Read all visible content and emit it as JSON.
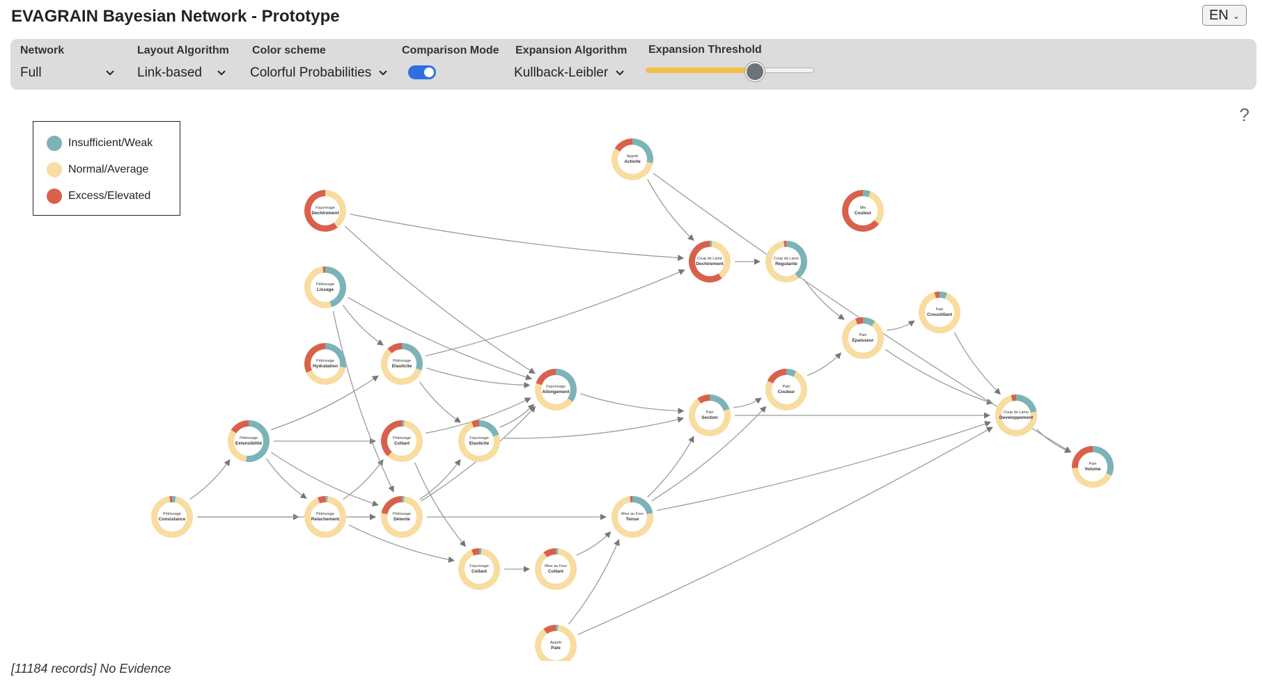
{
  "app": {
    "title": "EVAGRAIN Bayesian Network - Prototype"
  },
  "language": {
    "value": "EN"
  },
  "toolbar": {
    "network": {
      "label": "Network",
      "value": "Full"
    },
    "layout": {
      "label": "Layout Algorithm",
      "value": "Link-based"
    },
    "color_scheme": {
      "label": "Color scheme",
      "value": "Colorful Probabilities"
    },
    "comparison": {
      "label": "Comparison Mode",
      "enabled": true
    },
    "expansion_algo": {
      "label": "Expansion Algorithm",
      "value": "Kullback-Leibler"
    },
    "expansion_threshold": {
      "label": "Expansion Threshold",
      "value": 0.64
    }
  },
  "help": {
    "text": "?"
  },
  "legend": {
    "items": [
      {
        "label": "Insufficient/Weak",
        "color": "#7bb3b8"
      },
      {
        "label": "Normal/Average",
        "color": "#f8dca0"
      },
      {
        "label": "Excess/Elevated",
        "color": "#d9604b"
      }
    ]
  },
  "colors": {
    "weak": "#7bb3b8",
    "normal": "#f8dca0",
    "excess": "#d9604b",
    "toggle_on": "#2f6fe0",
    "slider_fill": "#f4c04a"
  },
  "status": {
    "text": "[11184 records] No Evidence"
  },
  "network": {
    "nodes": [
      {
        "id": "cons",
        "group": "Pétrissage",
        "name": "Consistance",
        "p": {
          "weak": 0.03,
          "normal": 0.95,
          "excess": 0.02
        }
      },
      {
        "id": "exten",
        "group": "Pétrissage",
        "name": "Extensibilité",
        "p": {
          "weak": 0.52,
          "normal": 0.32,
          "excess": 0.16
        }
      },
      {
        "id": "relach",
        "group": "Pétrissage",
        "name": "Relachement",
        "p": {
          "weak": 0.02,
          "normal": 0.92,
          "excess": 0.06
        }
      },
      {
        "id": "detente",
        "group": "Pétrissage",
        "name": "Detente",
        "p": {
          "weak": 0.02,
          "normal": 0.76,
          "excess": 0.22
        }
      },
      {
        "id": "pcollant",
        "group": "Pétrissage",
        "name": "Collant",
        "p": {
          "weak": 0.02,
          "normal": 0.6,
          "excess": 0.38
        }
      },
      {
        "id": "pelast",
        "group": "Pétrissage",
        "name": "Elasticite",
        "p": {
          "weak": 0.3,
          "normal": 0.58,
          "excess": 0.12
        }
      },
      {
        "id": "hydrat",
        "group": "Pétrissage",
        "name": "Hydratation",
        "p": {
          "weak": 0.28,
          "normal": 0.4,
          "excess": 0.32
        }
      },
      {
        "id": "lissage",
        "group": "Pétrissage",
        "name": "Lissage",
        "p": {
          "weak": 0.45,
          "normal": 0.53,
          "excess": 0.02
        }
      },
      {
        "id": "fdech",
        "group": "Façonnage",
        "name": "Dechirement",
        "p": {
          "weak": 0.0,
          "normal": 0.4,
          "excess": 0.6
        }
      },
      {
        "id": "felast",
        "group": "Façonnage",
        "name": "Elasticite",
        "p": {
          "weak": 0.2,
          "normal": 0.74,
          "excess": 0.06
        }
      },
      {
        "id": "fcollant",
        "group": "Façonnage",
        "name": "Collant",
        "p": {
          "weak": 0.02,
          "normal": 0.92,
          "excess": 0.06
        }
      },
      {
        "id": "fallong",
        "group": "Façonnage",
        "name": "Allongement",
        "p": {
          "weak": 0.35,
          "normal": 0.45,
          "excess": 0.2
        }
      },
      {
        "id": "mcollant",
        "group": "Mise au Four",
        "name": "Collant",
        "p": {
          "weak": 0.02,
          "normal": 0.88,
          "excess": 0.1
        }
      },
      {
        "id": "tenue",
        "group": "Mise au Four",
        "name": "Tenue",
        "p": {
          "weak": 0.22,
          "normal": 0.76,
          "excess": 0.02
        }
      },
      {
        "id": "apate",
        "group": "Apprêt",
        "name": "Pate",
        "p": {
          "weak": 0.02,
          "normal": 0.88,
          "excess": 0.1
        }
      },
      {
        "id": "aactiv",
        "group": "Apprêt",
        "name": "Activite",
        "p": {
          "weak": 0.28,
          "normal": 0.56,
          "excess": 0.16
        }
      },
      {
        "id": "cdech",
        "group": "Coup de Lame",
        "name": "Dechirement",
        "p": {
          "weak": 0.02,
          "normal": 0.38,
          "excess": 0.6
        }
      },
      {
        "id": "creg",
        "group": "Coup de Lame",
        "name": "Regularite",
        "p": {
          "weak": 0.4,
          "normal": 0.58,
          "excess": 0.02
        }
      },
      {
        "id": "cdev",
        "group": "Coup de Lame",
        "name": "Developpement",
        "p": {
          "weak": 0.22,
          "normal": 0.74,
          "excess": 0.04
        }
      },
      {
        "id": "psection",
        "group": "Pain",
        "name": "Section",
        "p": {
          "weak": 0.2,
          "normal": 0.7,
          "excess": 0.1
        }
      },
      {
        "id": "pcouleur",
        "group": "Pain",
        "name": "Couleur",
        "p": {
          "weak": 0.08,
          "normal": 0.74,
          "excess": 0.18
        }
      },
      {
        "id": "pepais",
        "group": "Pain",
        "name": "Epaisseur",
        "p": {
          "weak": 0.1,
          "normal": 0.84,
          "excess": 0.06
        }
      },
      {
        "id": "pcroust",
        "group": "Pain",
        "name": "Croustillant",
        "p": {
          "weak": 0.06,
          "normal": 0.9,
          "excess": 0.04
        }
      },
      {
        "id": "pvolume",
        "group": "Pain",
        "name": "Volume",
        "p": {
          "weak": 0.32,
          "normal": 0.42,
          "excess": 0.26
        }
      },
      {
        "id": "mcouleur",
        "group": "Mie",
        "name": "Couleur",
        "p": {
          "weak": 0.06,
          "normal": 0.3,
          "excess": 0.64
        }
      }
    ],
    "edges": [
      [
        "cons",
        "exten"
      ],
      [
        "cons",
        "relach"
      ],
      [
        "cons",
        "detente"
      ],
      [
        "exten",
        "relach"
      ],
      [
        "exten",
        "detente"
      ],
      [
        "exten",
        "pcollant"
      ],
      [
        "exten",
        "pelast"
      ],
      [
        "relach",
        "pcollant"
      ],
      [
        "relach",
        "detente"
      ],
      [
        "relach",
        "fcollant"
      ],
      [
        "lissage",
        "pelast"
      ],
      [
        "lissage",
        "detente"
      ],
      [
        "lissage",
        "fallong"
      ],
      [
        "pelast",
        "fallong"
      ],
      [
        "pelast",
        "felast"
      ],
      [
        "pelast",
        "cdech"
      ],
      [
        "pcollant",
        "fcollant"
      ],
      [
        "pcollant",
        "fallong"
      ],
      [
        "detente",
        "felast"
      ],
      [
        "detente",
        "fallong"
      ],
      [
        "detente",
        "tenue"
      ],
      [
        "felast",
        "fallong"
      ],
      [
        "felast",
        "psection"
      ],
      [
        "fallong",
        "psection"
      ],
      [
        "fcollant",
        "mcollant"
      ],
      [
        "mcollant",
        "tenue"
      ],
      [
        "apate",
        "tenue"
      ],
      [
        "apate",
        "cdev"
      ],
      [
        "tenue",
        "psection"
      ],
      [
        "tenue",
        "pcouleur"
      ],
      [
        "tenue",
        "cdev"
      ],
      [
        "psection",
        "pcouleur"
      ],
      [
        "psection",
        "cdev"
      ],
      [
        "pcouleur",
        "pepais"
      ],
      [
        "pepais",
        "pcroust"
      ],
      [
        "pepais",
        "cdev"
      ],
      [
        "pcroust",
        "cdev"
      ],
      [
        "cdech",
        "creg"
      ],
      [
        "creg",
        "pepais"
      ],
      [
        "cdev",
        "pvolume"
      ],
      [
        "aactiv",
        "cdech"
      ],
      [
        "aactiv",
        "pvolume"
      ],
      [
        "fdech",
        "cdech"
      ],
      [
        "fdech",
        "fallong"
      ]
    ]
  }
}
